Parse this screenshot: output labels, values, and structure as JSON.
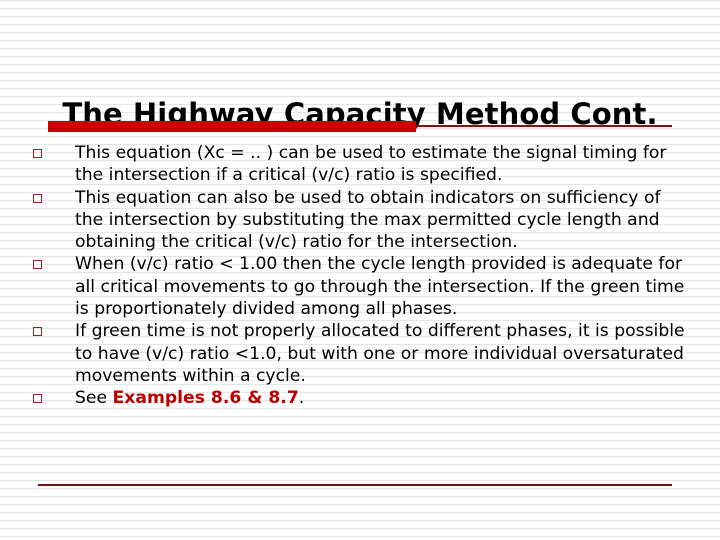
{
  "slide": {
    "title": "The Highway Capacity Method Cont.",
    "accent_color": "#cc0000",
    "rule_color": "#8a1010",
    "bullet_marker_color": "#9b2020",
    "bullets": [
      {
        "text": "This equation (Xc = .. )  can be used to estimate the signal timing for the intersection if a critical (v/c) ratio is specified."
      },
      {
        "text": "This equation can also be used to obtain indicators on sufficiency  of the intersection by substituting the max permitted cycle length and obtaining the critical (v/c) ratio for the intersection."
      },
      {
        "text": "When (v/c) ratio < 1.00 then the cycle length provided is adequate for all critical movements to go through the intersection. If the green time is proportionately divided among all phases."
      },
      {
        "text": "If green time is not properly allocated to different phases, it is possible to have (v/c) ratio <1.0, but with one or more individual oversaturated movements within a cycle."
      },
      {
        "prefix": "See ",
        "accent": "Examples 8.6 & 8.7",
        "suffix": "."
      }
    ]
  }
}
